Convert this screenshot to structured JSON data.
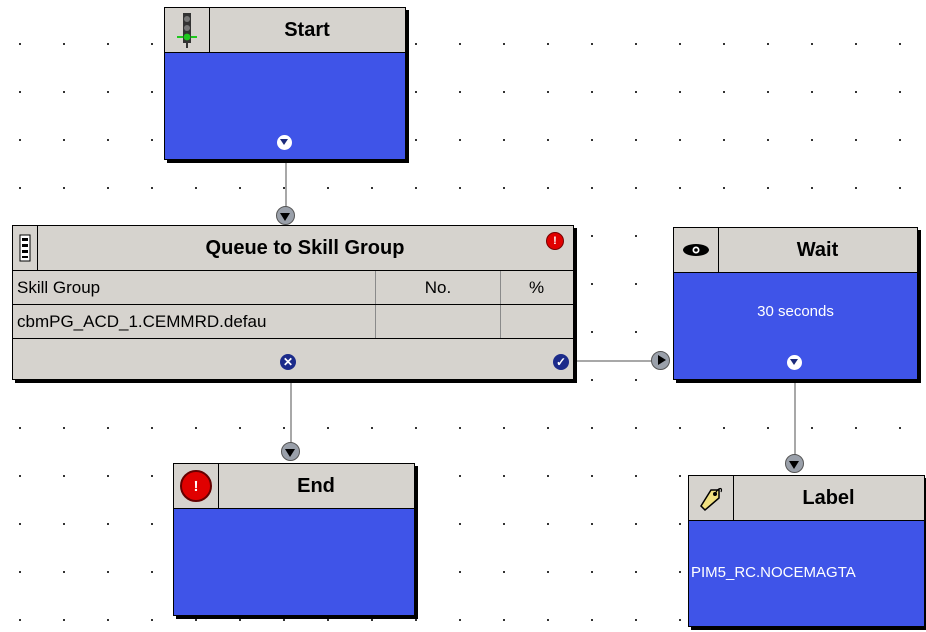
{
  "nodes": {
    "start": {
      "title": "Start",
      "icon": "traffic-light-icon"
    },
    "queue": {
      "title": "Queue to Skill Group",
      "icon": "queue-icon",
      "columns": [
        "Skill Group",
        "No.",
        "%"
      ],
      "rows": [
        [
          "cbmPG_ACD_1.CEMMRD.defau",
          "",
          ""
        ]
      ],
      "fail_symbol": "✕",
      "success_symbol": "✓",
      "error_symbol": "!"
    },
    "wait": {
      "title": "Wait",
      "icon": "eye-icon",
      "body": "30 seconds"
    },
    "end": {
      "title": "End",
      "icon": "stop-icon",
      "icon_symbol": "!"
    },
    "label": {
      "title": "Label",
      "icon": "tag-icon",
      "body": "PIM5_RC.NOCEMAGTA"
    }
  },
  "colors": {
    "node_body": "#3f54e8",
    "header": "#d6d3ce",
    "wire": "#a8a8a8"
  }
}
